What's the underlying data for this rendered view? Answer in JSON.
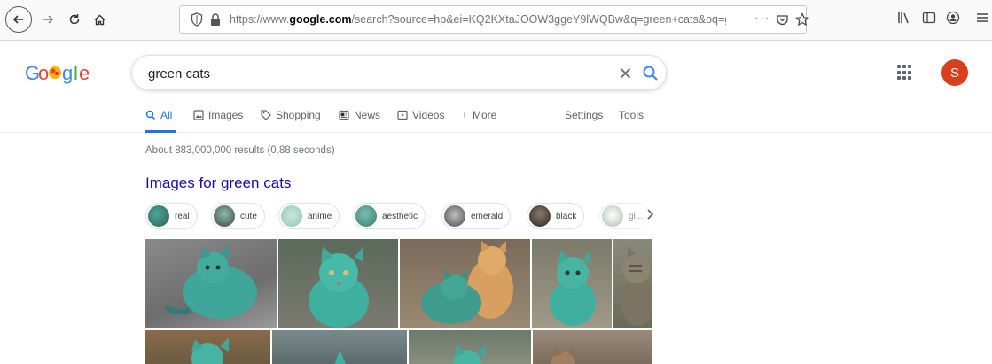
{
  "browser": {
    "url_prefix": "https://www.",
    "url_host": "google.com",
    "url_rest": "/search?source=hp&ei=KQ2KXtaJOOW3ggeY9lWQBw&q=green+cats&oq=gree",
    "more_label": "···"
  },
  "search": {
    "query": "green cats",
    "clear_label": "✕"
  },
  "account": {
    "initial": "S",
    "color": "#d93f1a"
  },
  "tabs": [
    {
      "label": "All",
      "icon": "search-icon"
    },
    {
      "label": "Images",
      "icon": "image-icon"
    },
    {
      "label": "Shopping",
      "icon": "tag-icon"
    },
    {
      "label": "News",
      "icon": "newspaper-icon"
    },
    {
      "label": "Videos",
      "icon": "play-icon"
    },
    {
      "label": "More",
      "icon": "more-vert-icon"
    }
  ],
  "tools": {
    "settings": "Settings",
    "tools": "Tools"
  },
  "results": {
    "stats": "About 883,000,000 results (0.88 seconds)",
    "images_heading": "Images for green cats"
  },
  "chips": [
    {
      "label": "real"
    },
    {
      "label": "cute"
    },
    {
      "label": "anime"
    },
    {
      "label": "aesthetic"
    },
    {
      "label": "emerald"
    },
    {
      "label": "black"
    },
    {
      "label": "gl..."
    }
  ],
  "colors": {
    "accent": "#1a73e8",
    "link": "#1a0dab",
    "cat_green": "#3fa69a"
  }
}
